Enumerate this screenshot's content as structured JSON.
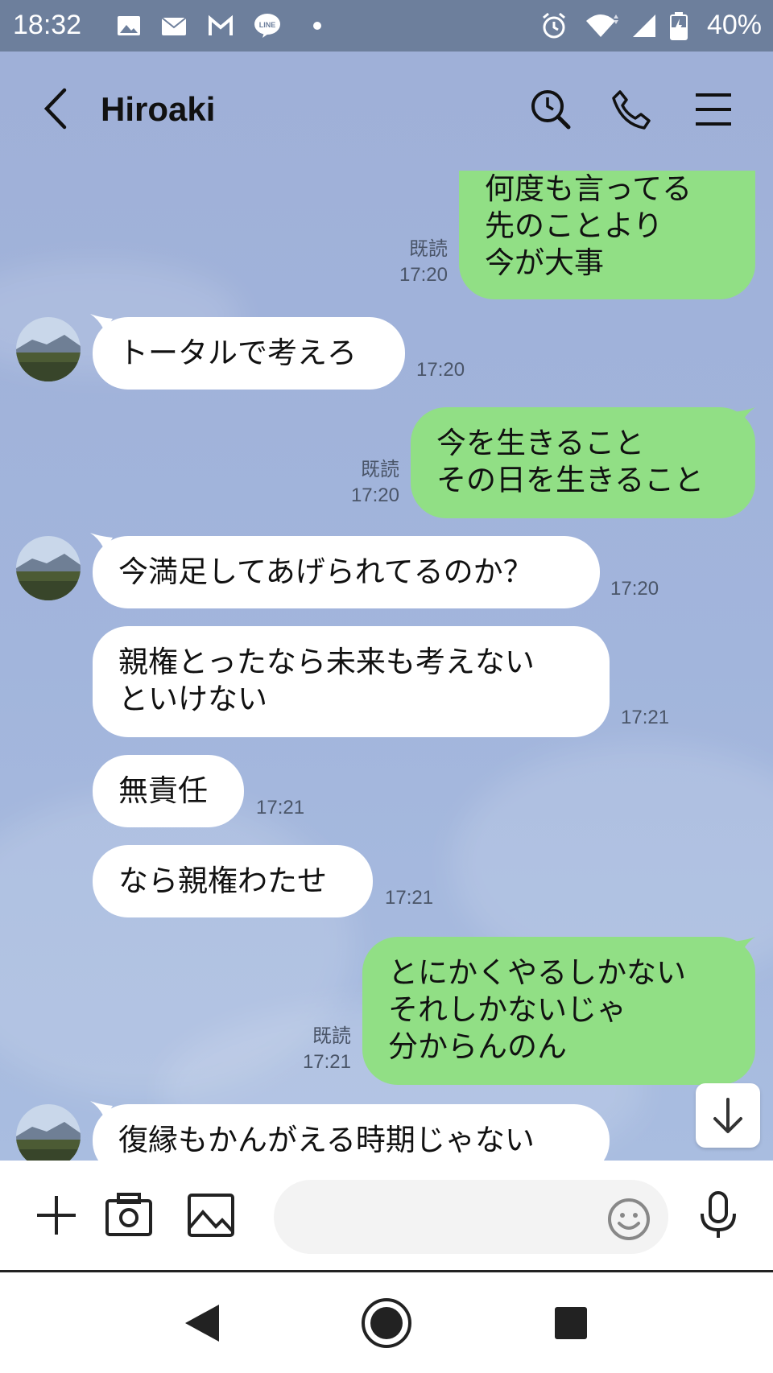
{
  "status_bar": {
    "time": "18:32",
    "battery": "40%",
    "left_icons": [
      "gallery-icon",
      "au-mail-icon",
      "gmail-icon",
      "line-icon",
      "dot-icon"
    ],
    "right_icons": [
      "alarm-icon",
      "wifi-icon",
      "signal-icon",
      "battery-icon"
    ]
  },
  "header": {
    "title": "Hiroaki",
    "icons": [
      "back-icon",
      "search-icon",
      "phone-icon",
      "menu-icon"
    ]
  },
  "colors": {
    "chat_bg": "#a2b5dc",
    "outgoing_bubble": "#91df85",
    "incoming_bubble": "#ffffff",
    "status_bar": "#6d7f9c"
  },
  "messages": [
    {
      "dir": "out",
      "lines": [
        "何度も言ってる",
        "先のことより",
        "今が大事"
      ],
      "read": "既読",
      "time": "17:20"
    },
    {
      "dir": "in",
      "lines": [
        "トータルで考えろ"
      ],
      "time": "17:20"
    },
    {
      "dir": "out",
      "lines": [
        "今を生きること",
        "その日を生きること"
      ],
      "read": "既読",
      "time": "17:20"
    },
    {
      "dir": "in",
      "lines": [
        "今満足してあげられてるのか？"
      ],
      "time": "17:20"
    },
    {
      "dir": "in",
      "lines": [
        "親権とったなら未来も考えない",
        "といけない"
      ],
      "time": "17:21"
    },
    {
      "dir": "in",
      "lines": [
        "無責任"
      ],
      "time": "17:21"
    },
    {
      "dir": "in",
      "lines": [
        "なら親権わたせ"
      ],
      "time": "17:21"
    },
    {
      "dir": "out",
      "lines": [
        "とにかくやるしかない",
        "それしかないじゃ",
        "分からんのん"
      ],
      "read": "既読",
      "time": "17:21"
    },
    {
      "dir": "in",
      "lines": [
        "復縁もかんがえる時期じゃない"
      ]
    }
  ],
  "input_bar": {
    "placeholder": "",
    "icons": [
      "plus-icon",
      "camera-icon",
      "image-icon",
      "emoji-icon",
      "mic-icon"
    ]
  },
  "nav_bar": {
    "icons": [
      "nav-back-icon",
      "nav-home-icon",
      "nav-recents-icon"
    ]
  }
}
